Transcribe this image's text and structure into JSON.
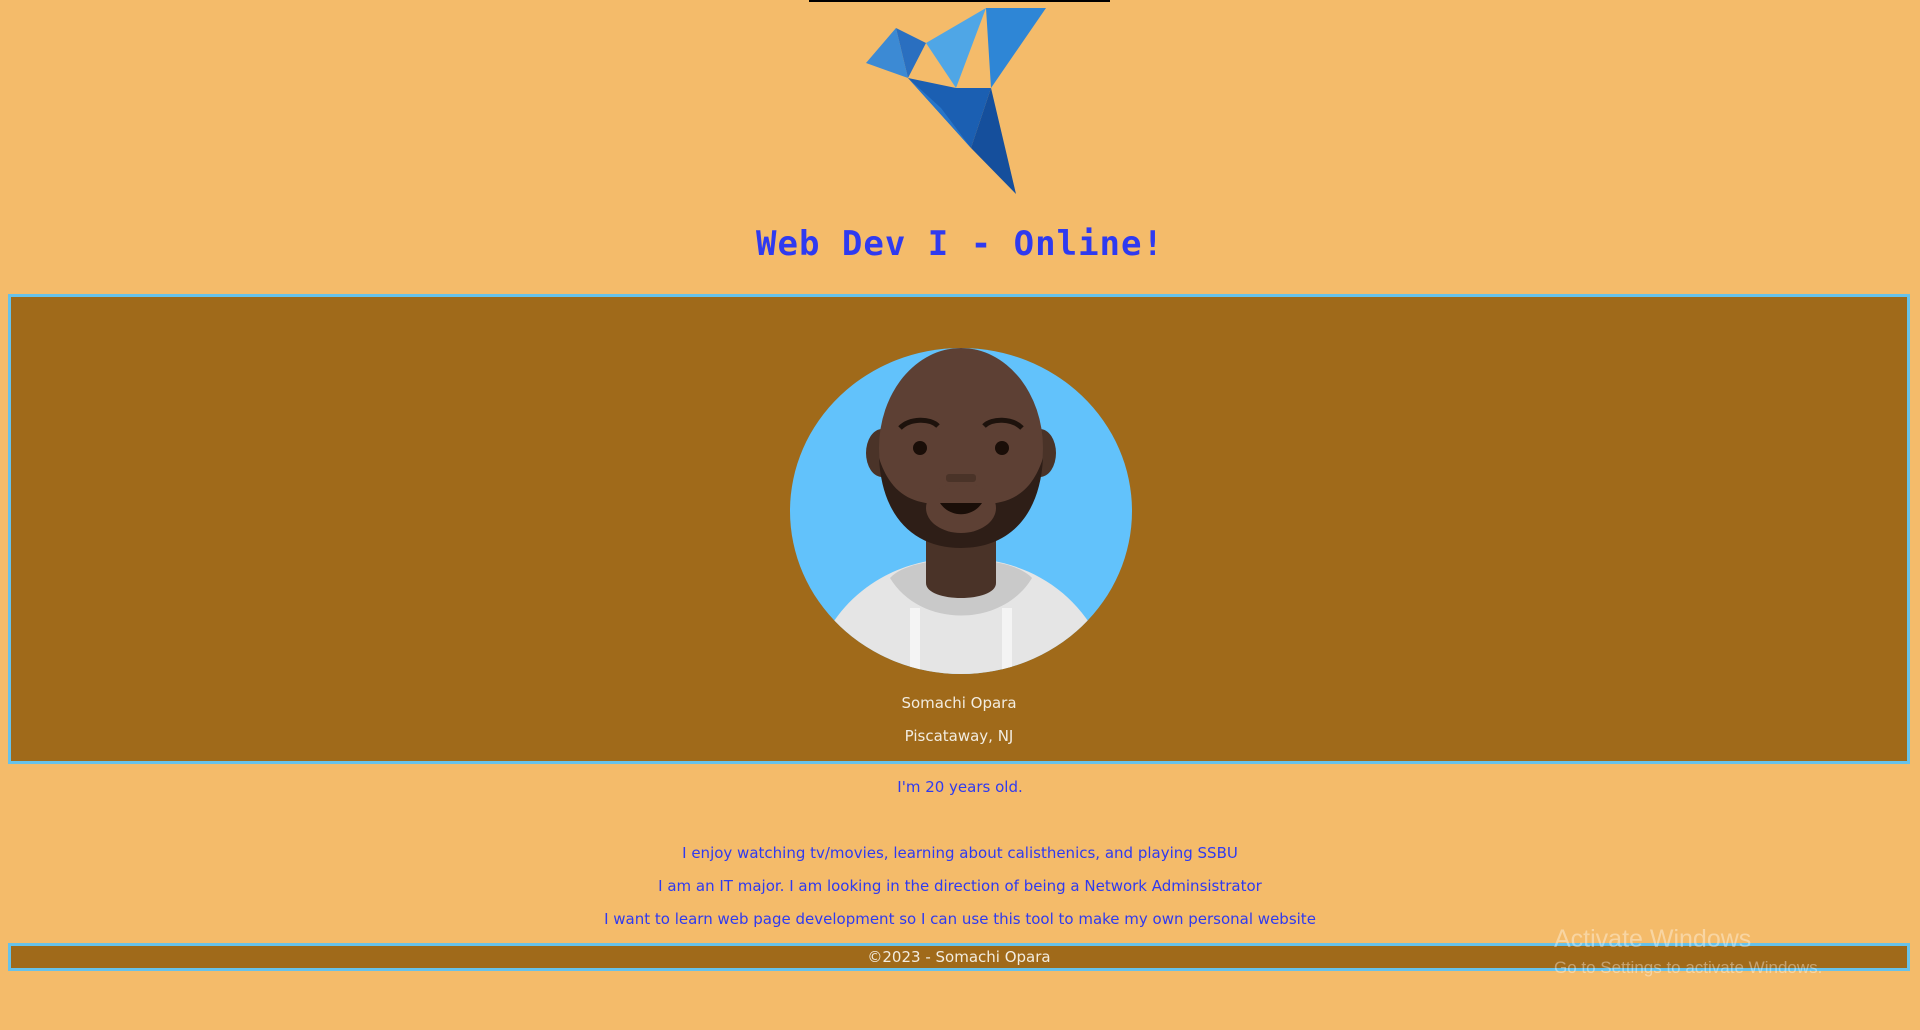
{
  "header": {
    "logo_icon": "origami-bird-icon",
    "title": "Web Dev I - Online!"
  },
  "profile": {
    "avatar_icon": "bald-bearded-man-avatar",
    "name": "Somachi Opara",
    "location": "Piscataway, NJ"
  },
  "about": {
    "age": "I'm 20 years old.",
    "hobbies": "I enjoy watching tv/movies, learning about calisthenics, and playing SSBU",
    "major": "I am an IT major. I am looking in the direction of being a Network Adminsistrator",
    "goal": "I want to learn web page development so I can use this tool to make my own personal website"
  },
  "footer": {
    "copyright": "©2023 - Somachi Opara"
  },
  "watermark": {
    "title": "Activate Windows",
    "subtitle": "Go to Settings to activate Windows."
  },
  "colors": {
    "background": "#f4bb6a",
    "card": "#a06a1a",
    "border": "#67c2ea",
    "accent_text": "#2f3af0"
  }
}
